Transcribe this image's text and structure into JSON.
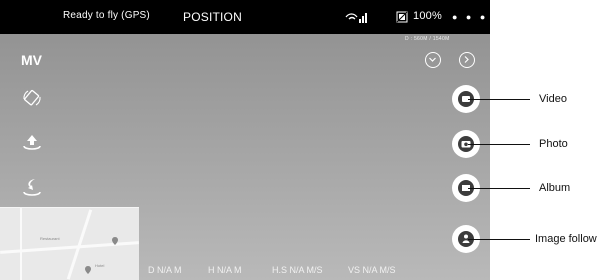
{
  "status_bar": {
    "gps_status": "Ready to fly (GPS)",
    "flight_mode": "POSITION",
    "battery_percent": "100%",
    "more_icon": "more-dots-icon"
  },
  "camera_view": {
    "mode_label": "MV",
    "distance_readout": "D : 560M / 1540M"
  },
  "left_controls": [
    {
      "name": "rotate-icon"
    },
    {
      "name": "takeoff-icon"
    },
    {
      "name": "return-home-icon"
    }
  ],
  "right_controls": [
    {
      "name": "video-button",
      "callout": "Video"
    },
    {
      "name": "photo-button",
      "callout": "Photo"
    },
    {
      "name": "album-button",
      "callout": "Album"
    },
    {
      "name": "image-follow-button",
      "callout": "Image follow"
    }
  ],
  "telemetry": {
    "d": "D N/A M",
    "h": "H N/A M",
    "hs": "H.S N/A M/S",
    "vs": "VS  N/A M/S"
  },
  "map": {
    "label_1": "Restaurant",
    "label_2": "Hotel"
  }
}
